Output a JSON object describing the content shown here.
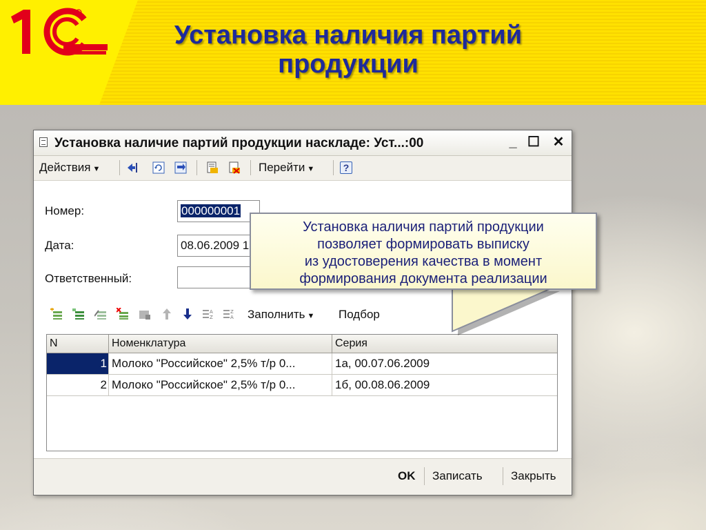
{
  "slide": {
    "title_line1": "Установка наличия партий",
    "title_line2": "продукции",
    "logo_text": "1С",
    "colors": {
      "header_yellow": "#ffe100",
      "logo_red": "#e2001a",
      "title_blue": "#1e2a9a"
    }
  },
  "window": {
    "title": "Установка наличие партий продукции наскладе: Уст...:00",
    "controls": {
      "minimize": "_",
      "maximize": "☐",
      "close": "✕"
    },
    "toolbar": {
      "actions": "Действия",
      "goto": "Перейти",
      "help": "?"
    },
    "form": {
      "number_label": "Номер:",
      "number_value": "000000001",
      "date_label": "Дата:",
      "date_value": "08.06.2009 1",
      "responsible_label": "Ответственный:",
      "responsible_value": ""
    },
    "table_toolbar": {
      "fill": "Заполнить",
      "select": "Подбор"
    },
    "table": {
      "columns": [
        "N",
        "Номенклатура",
        "Серия"
      ],
      "rows": [
        {
          "n": "1",
          "item": "Молоко \"Российское\" 2,5% т/р 0...",
          "series": "1а, 00.07.06.2009"
        },
        {
          "n": "2",
          "item": "Молоко \"Российское\" 2,5% т/р 0...",
          "series": "1б, 00.08.06.2009"
        }
      ]
    },
    "buttons": {
      "ok": "OK",
      "save": "Записать",
      "close": "Закрыть"
    }
  },
  "callout": {
    "line1": "Установка наличия партий продукции",
    "line2": "позволяет формировать выписку",
    "line3": "из удостоверения качества в момент",
    "line4": "формирования документа реализации"
  }
}
